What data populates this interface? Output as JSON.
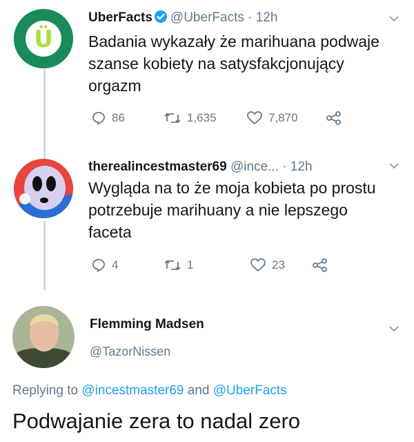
{
  "colors": {
    "accent": "#1da1f2",
    "secondary_text": "#657786",
    "uberfacts_logo_bg": "#1a8a5a",
    "uberfacts_logo_fg": "#a7e03b",
    "thread_line": "#cfd9de"
  },
  "tweet1": {
    "display_name": "UberFacts",
    "handle": "@UberFacts",
    "separator": "·",
    "time": "12h",
    "avatar_letter": "Ü",
    "verified": true,
    "text": "Badania wykazały że marihuana podwaje szanse kobiety na satysfakcjonujący orgazm",
    "replies": "86",
    "retweets": "1,635",
    "likes": "7,870"
  },
  "tweet2": {
    "display_name": "therealincestmaster69",
    "handle": "@ince...",
    "separator": "·",
    "time": "12h",
    "text": "Wygląda na to że moja kobieta po prostu potrzebuje marihuany a nie lepszego faceta",
    "replies": "4",
    "retweets": "1",
    "likes": "23"
  },
  "reply": {
    "display_name": "Flemming Madsen",
    "handle": "@TazorNissen",
    "replying_prefix": "Replying to",
    "mention1": "@incestmaster69",
    "conjunction": "and",
    "mention2": "@UberFacts",
    "text": "Podwajanie zera to nadal zero"
  },
  "icons": {
    "reply": "reply-bubble-icon",
    "retweet": "retweet-icon",
    "like": "heart-icon",
    "share": "share-icon",
    "menu": "chevron-down-icon",
    "verified": "verified-badge-icon"
  }
}
